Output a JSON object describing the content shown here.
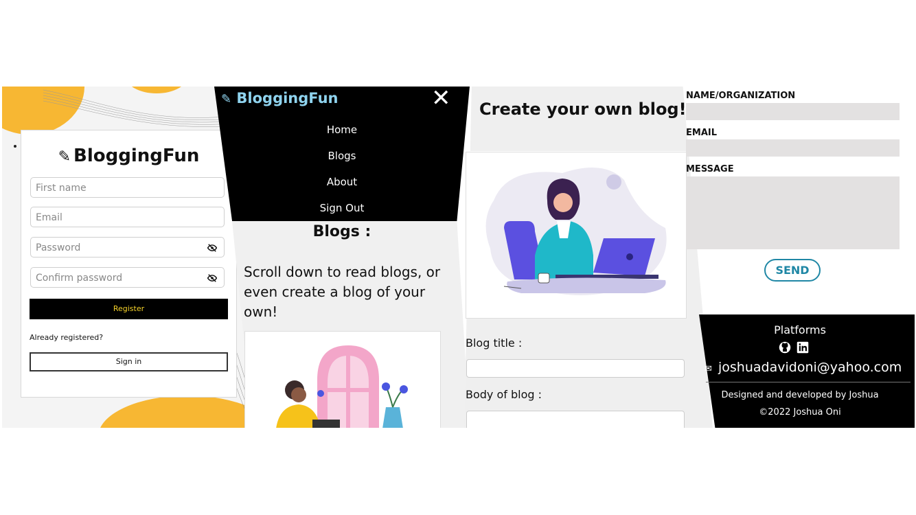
{
  "register": {
    "brand": "BloggingFun",
    "first_name_placeholder": "First name",
    "email_placeholder": "Email",
    "password_placeholder": "Password",
    "confirm_password_placeholder": "Confirm password",
    "register_label": "Register",
    "already_registered": "Already registered?",
    "sign_in_label": "Sign in"
  },
  "nav": {
    "brand": "BloggingFun",
    "close_icon": "close-icon",
    "items": [
      "Home",
      "Blogs",
      "About",
      "Sign Out"
    ]
  },
  "blogs": {
    "heading": "Blogs :",
    "intro": "Scroll down to read blogs, or even create a blog of your own!"
  },
  "create": {
    "heading": "Create your own blog!",
    "title_label": "Blog title :",
    "body_label": "Body of blog :"
  },
  "contact": {
    "name_label": "NAME/ORGANIZATION",
    "email_label": "EMAIL",
    "message_label": "MESSAGE",
    "send_label": "SEND"
  },
  "footer": {
    "platforms": "Platforms",
    "email": "joshuadavidoni@yahoo.com",
    "credit": "Designed and developed by Joshua",
    "copyright": "©2022 Joshua Oni"
  },
  "colors": {
    "accent_yellow": "#f7b733",
    "register_text": "#f5d22a",
    "brand_blue": "#8fd3ee",
    "send_teal": "#1f87a5",
    "illustration_purple": "#5b50e0",
    "illustration_teal": "#1fb8c9"
  }
}
